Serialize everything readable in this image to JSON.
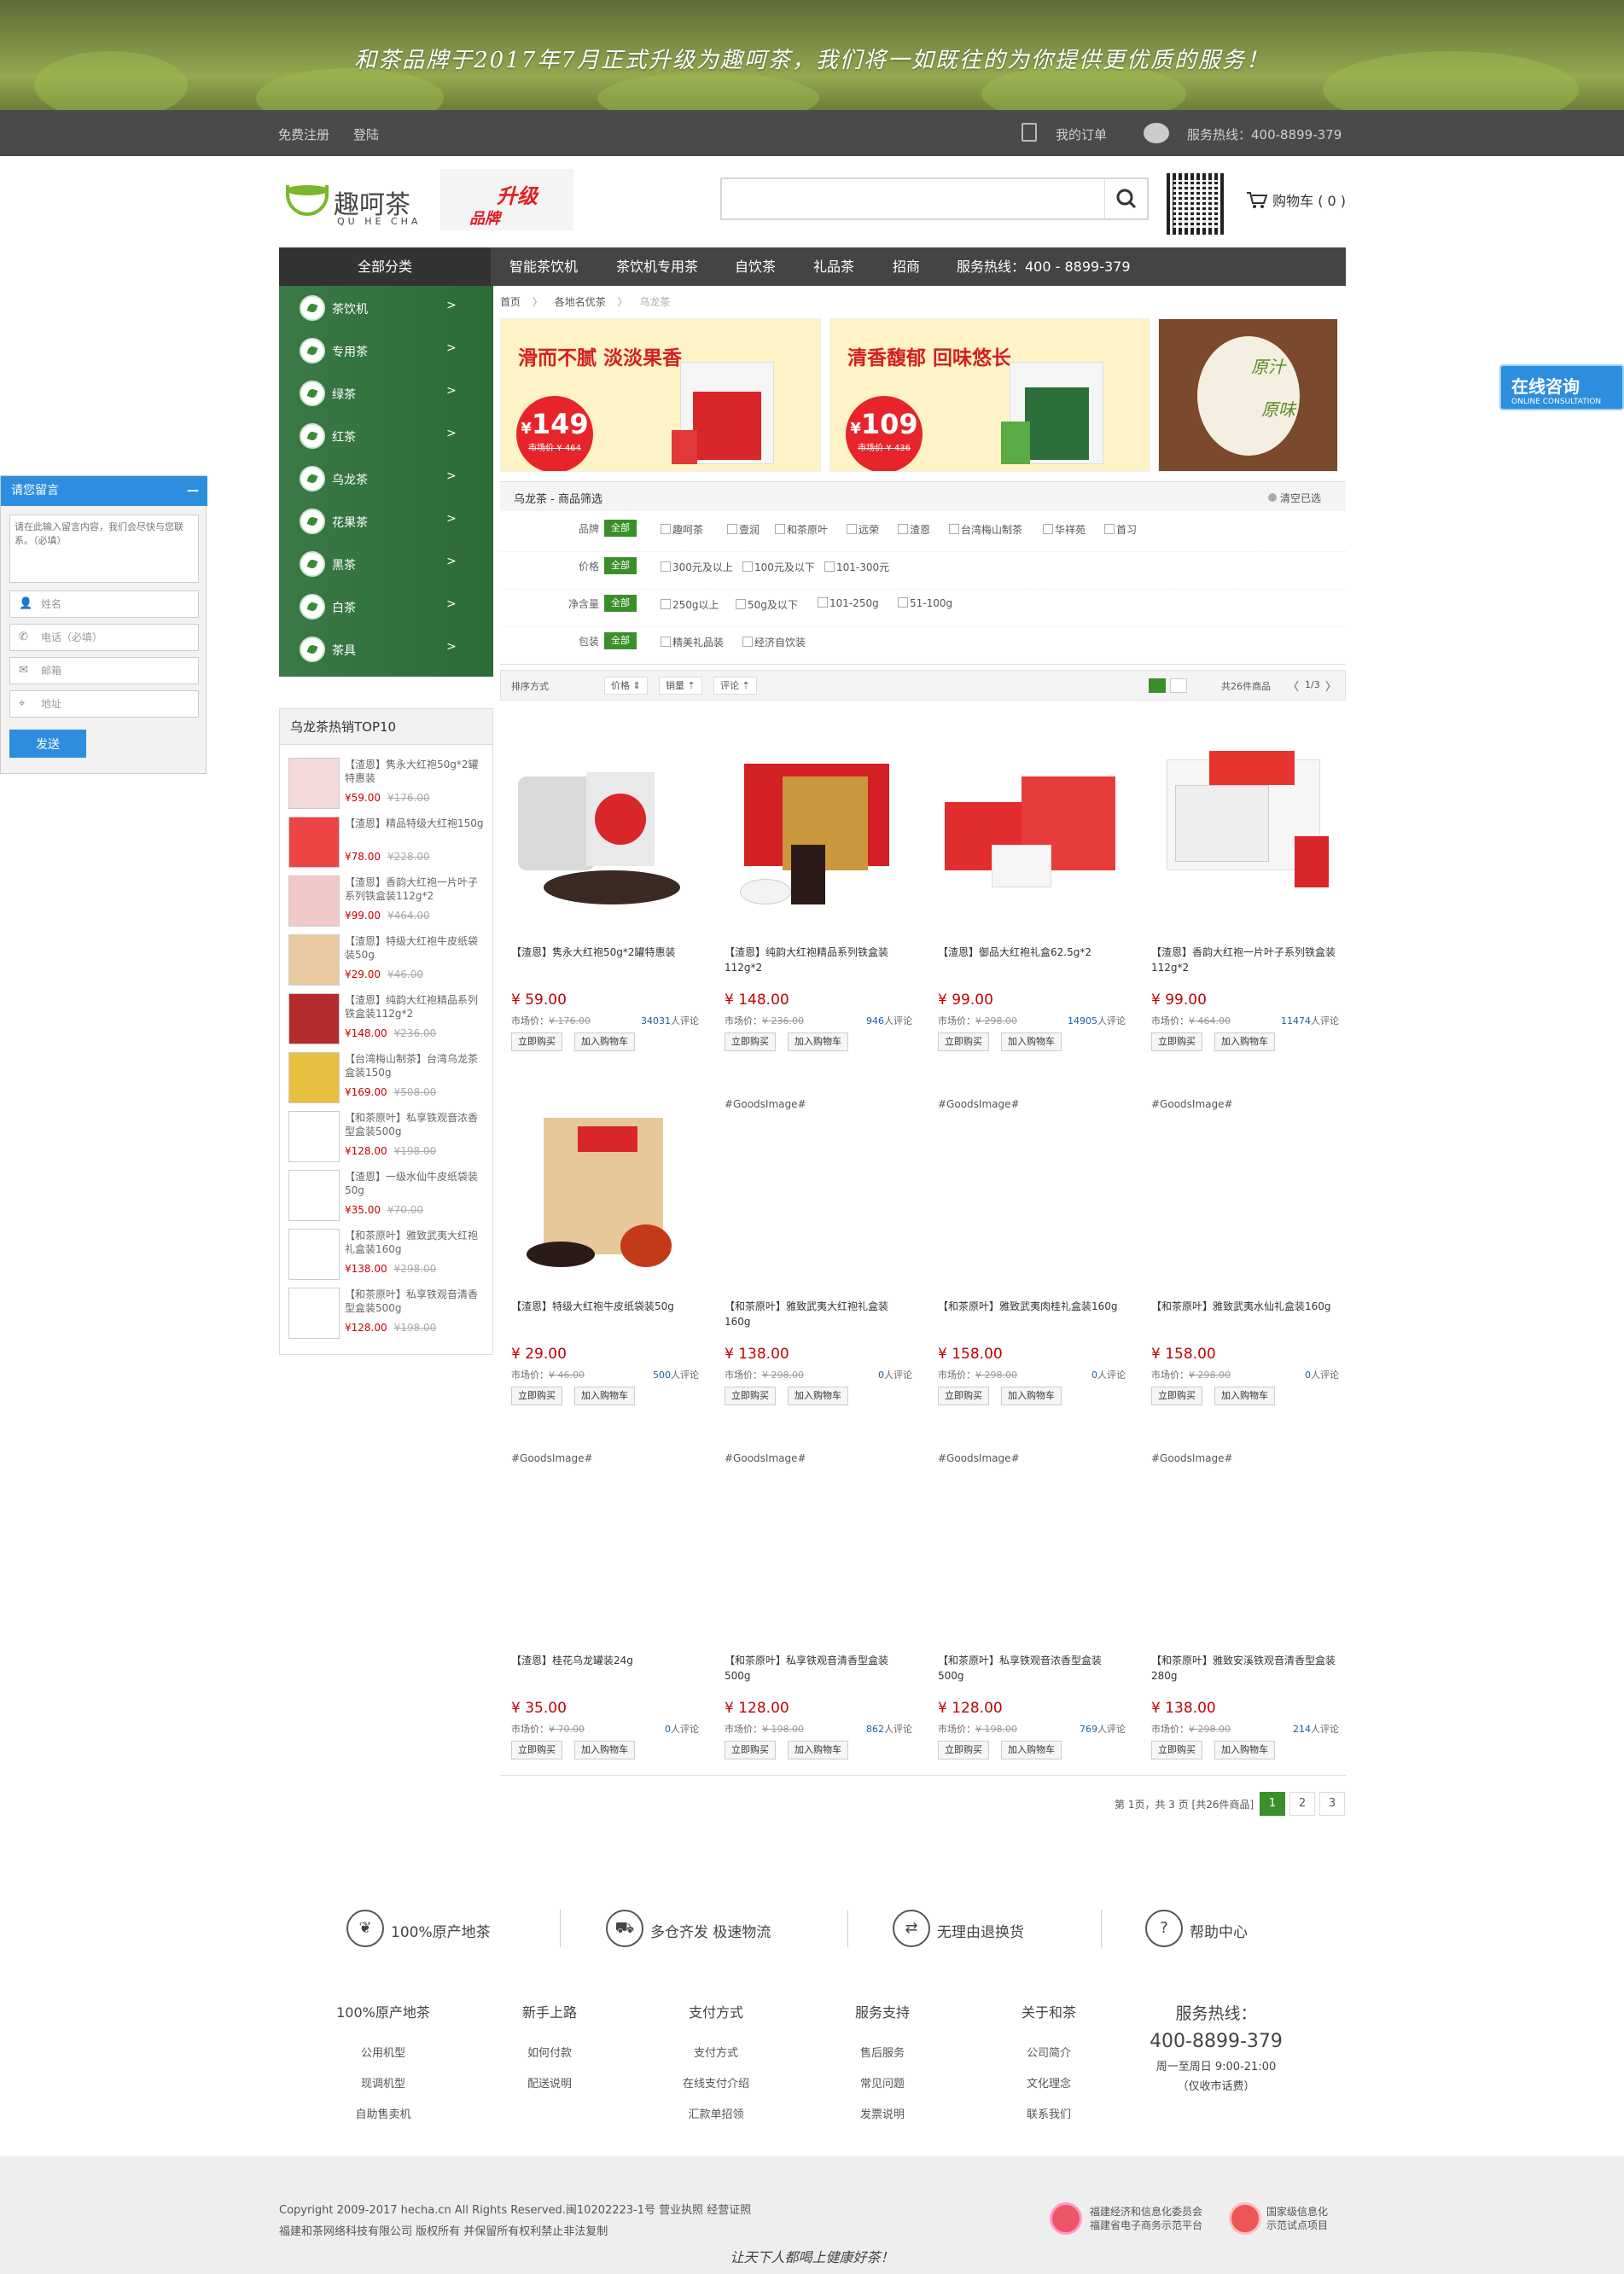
{
  "banner": {
    "text": "和茶品牌于2017年7月正式升级为趣呵茶，我们将一如既往的为你提供更优质的服务！"
  },
  "topbar": {
    "register": "免费注册",
    "login": "登陆",
    "orders": "我的订单",
    "hotline": "服务热线：400-8899-379"
  },
  "header": {
    "brand": "趣呵茶",
    "brand_pinyin": "QU HE CHA",
    "upgrade_1": "升级",
    "upgrade_2": "品牌",
    "cart_label": "购物车",
    "cart_count": "( 0 )"
  },
  "search": {
    "placeholder": ""
  },
  "nav": {
    "all": "全部分类",
    "items": [
      "智能茶饮机",
      "茶饮机专用茶",
      "自饮茶",
      "礼品茶",
      "招商",
      "服务热线：400 - 8899-379"
    ]
  },
  "categories": [
    "茶饮机",
    "专用茶",
    "绿茶",
    "红茶",
    "乌龙茶",
    "花果茶",
    "黑茶",
    "白茶",
    "茶具"
  ],
  "breadcrumb": {
    "home": "首页",
    "sep": "〉",
    "level1": "各地名优茶",
    "current": "乌龙茶"
  },
  "promos": [
    {
      "title": "滑而不腻 淡淡果香",
      "price": "149",
      "market": "市场价 ¥ 464"
    },
    {
      "title": "清香馥郁 回味悠长",
      "price": "109",
      "market": "市场价 ¥ 436"
    },
    {
      "label_1": "原汁",
      "label_2": "原味"
    }
  ],
  "filter": {
    "heading": "乌龙茶 - 商品筛选",
    "clear": "清空已选",
    "all": "全部",
    "rows": [
      {
        "label": "品牌",
        "options": [
          "趣呵茶",
          "壹润",
          "和茶原叶",
          "远荣",
          "渣恩",
          "台湾梅山制茶",
          "华祥苑",
          "首习"
        ]
      },
      {
        "label": "价格",
        "options": [
          "300元及以上",
          "100元及以下",
          "101-300元"
        ]
      },
      {
        "label": "净含量",
        "options": [
          "250g以上",
          "50g及以下",
          "101-250g",
          "51-100g"
        ]
      },
      {
        "label": "包装",
        "options": [
          "精美礼品装",
          "经济自饮装"
        ]
      }
    ]
  },
  "sort": {
    "label": "排序方式",
    "price": "价格 ⇕",
    "sales": "销量 ⇡",
    "reviews": "评论 ⇡",
    "total": "共26件商品",
    "page": "1/3"
  },
  "top10": {
    "title": "乌龙茶热销TOP10",
    "items": [
      {
        "name": "【渣恩】隽永大红袍50g*2罐特惠装",
        "price": "¥59.00",
        "market": "¥176.00"
      },
      {
        "name": "【渣恩】精品特级大红袍150g",
        "price": "¥78.00",
        "market": "¥228.00"
      },
      {
        "name": "【渣恩】香韵大红袍一片叶子系列铁盒装112g*2",
        "price": "¥99.00",
        "market": "¥464.00"
      },
      {
        "name": "【渣恩】特级大红袍牛皮纸袋装50g",
        "price": "¥29.00",
        "market": "¥46.00"
      },
      {
        "name": "【渣恩】纯韵大红袍精品系列铁盒装112g*2",
        "price": "¥148.00",
        "market": "¥236.00"
      },
      {
        "name": "【台湾梅山制茶】台湾乌龙茶盒装150g",
        "price": "¥169.00",
        "market": "¥508.00"
      },
      {
        "name": "【和茶原叶】私享铁观音浓香型盒装500g",
        "price": "¥128.00",
        "market": "¥198.00"
      },
      {
        "name": "【渣恩】一级水仙牛皮纸袋装50g",
        "price": "¥35.00",
        "market": "¥70.00"
      },
      {
        "name": "【和茶原叶】雅致武夷大红袍礼盒装160g",
        "price": "¥138.00",
        "market": "¥298.00"
      },
      {
        "name": "【和茶原叶】私享铁观音清香型盒装500g",
        "price": "¥128.00",
        "market": "¥198.00"
      }
    ]
  },
  "products": [
    {
      "img": "",
      "name": "【渣恩】隽永大红袍50g*2罐特惠装",
      "price": "¥ 59.00",
      "market": "¥ 176.00",
      "reviews": "34031",
      "buy": "立即购买",
      "add": "加入购物车"
    },
    {
      "img": "",
      "name": "【渣恩】纯韵大红袍精品系列铁盒装112g*2",
      "price": "¥ 148.00",
      "market": "¥ 236.00",
      "reviews": "946",
      "buy": "立即购买",
      "add": "加入购物车"
    },
    {
      "img": "",
      "name": "【渣恩】御品大红袍礼盒62.5g*2",
      "price": "¥ 99.00",
      "market": "¥ 298.00",
      "reviews": "14905",
      "buy": "立即购买",
      "add": "加入购物车"
    },
    {
      "img": "",
      "name": "【渣恩】香韵大红袍一片叶子系列铁盒装112g*2",
      "price": "¥ 99.00",
      "market": "¥ 464.00",
      "reviews": "11474",
      "buy": "立即购买",
      "add": "加入购物车"
    },
    {
      "img": "",
      "name": "【渣恩】特级大红袍牛皮纸袋装50g",
      "price": "¥ 29.00",
      "market": "¥ 46.00",
      "reviews": "500",
      "buy": "立即购买",
      "add": "加入购物车"
    },
    {
      "img": "#GoodsImage#",
      "name": "【和茶原叶】雅致武夷大红袍礼盒装160g",
      "price": "¥ 138.00",
      "market": "¥ 298.00",
      "reviews": "0",
      "buy": "立即购买",
      "add": "加入购物车"
    },
    {
      "img": "#GoodsImage#",
      "name": "【和茶原叶】雅致武夷肉桂礼盒装160g",
      "price": "¥ 158.00",
      "market": "¥ 298.00",
      "reviews": "0",
      "buy": "立即购买",
      "add": "加入购物车"
    },
    {
      "img": "#GoodsImage#",
      "name": "【和茶原叶】雅致武夷水仙礼盒装160g",
      "price": "¥ 158.00",
      "market": "¥ 298.00",
      "reviews": "0",
      "buy": "立即购买",
      "add": "加入购物车"
    },
    {
      "img": "#GoodsImage#",
      "name": "【渣恩】桂花乌龙罐装24g",
      "price": "¥ 35.00",
      "market": "¥ 70.00",
      "reviews": "0",
      "buy": "立即购买",
      "add": "加入购物车"
    },
    {
      "img": "#GoodsImage#",
      "name": "【和茶原叶】私享铁观音清香型盒装500g",
      "price": "¥ 128.00",
      "market": "¥ 198.00",
      "reviews": "862",
      "buy": "立即购买",
      "add": "加入购物车"
    },
    {
      "img": "#GoodsImage#",
      "name": "【和茶原叶】私享铁观音浓香型盒装500g",
      "price": "¥ 128.00",
      "market": "¥ 198.00",
      "reviews": "769",
      "buy": "立即购买",
      "add": "加入购物车"
    },
    {
      "img": "#GoodsImage#",
      "name": "【和茶原叶】雅致安溪铁观音清香型盒装280g",
      "price": "¥ 138.00",
      "market": "¥ 298.00",
      "reviews": "214",
      "buy": "立即购买",
      "add": "加入购物车"
    }
  ],
  "product_labels": {
    "market_prefix": "市场价：",
    "reviews_suffix": "人评论"
  },
  "pager": {
    "info": "第 1页，共 3 页 [共26件商品]",
    "pages": [
      "1",
      "2",
      "3"
    ]
  },
  "services": [
    "100%原产地茶",
    "多仓齐发 极速物流",
    "无理由退换货",
    "帮助中心"
  ],
  "footer_cols": [
    {
      "h": "100%原产地茶",
      "items": [
        "公用机型",
        "现调机型",
        "自助售卖机"
      ]
    },
    {
      "h": "新手上路",
      "items": [
        "如何付款",
        "配送说明"
      ]
    },
    {
      "h": "支付方式",
      "items": [
        "支付方式",
        "在线支付介绍",
        "汇款单招领"
      ]
    },
    {
      "h": "服务支持",
      "items": [
        "售后服务",
        "常见问题",
        "发票说明"
      ]
    },
    {
      "h": "关于和茶",
      "items": [
        "公司简介",
        "文化理念",
        "联系我们"
      ]
    }
  ],
  "hotline": {
    "title": "服务热线：",
    "number": "400-8899-379",
    "hours": "周一至周日 9:00-21:00",
    "note": "（仅收市话费）"
  },
  "footer": {
    "copyright": "Copyright 2009-2017 hecha.cn All Rights Reserved.闽10202223-1号 营业执照 经营证照",
    "company": "福建和茶网络科技有限公司 版权所有 并保留所有权利禁止非法复制",
    "badge1_1": "福建经济和信息化委员会",
    "badge1_2": "福建省电子商务示范平台",
    "badge2_1": "国家级信息化",
    "badge2_2": "示范试点项目",
    "slogan": "让天下人都喝上健康好茶！"
  },
  "message_widget": {
    "title": "请您留言",
    "minimize": "—",
    "textarea": "请在此输入留言内容，我们会尽快与您联系。（必填）",
    "fields": [
      "姓名",
      "电话（必填）",
      "邮箱",
      "地址"
    ],
    "send": "发送"
  },
  "online": {
    "title": "在线咨询",
    "sub": "ONLINE CONSULTATION"
  },
  "colors": {
    "accent_green": "#3a8f2a",
    "price_red": "#c40000",
    "widget_blue": "#2d8ee0"
  }
}
